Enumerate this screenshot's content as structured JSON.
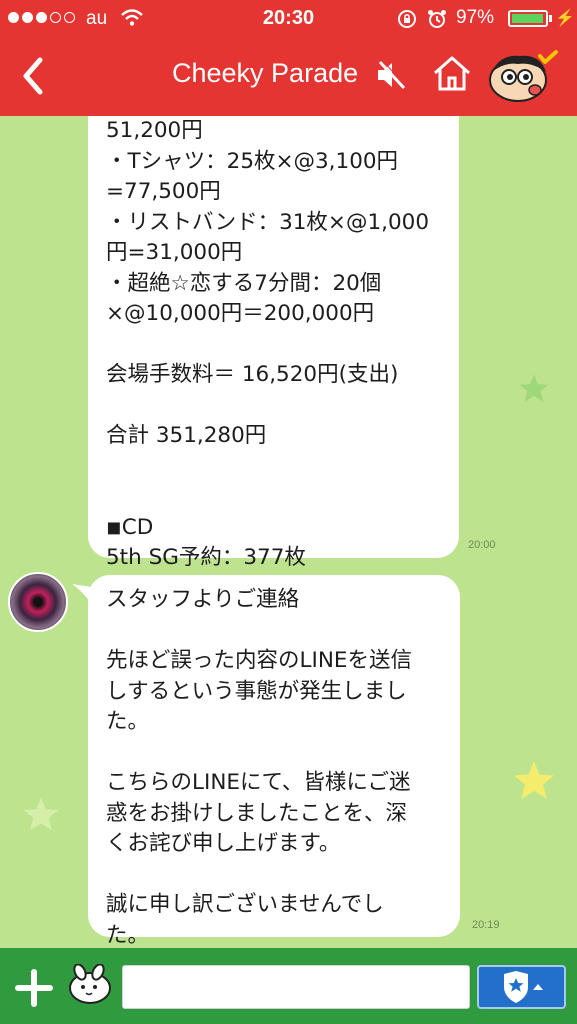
{
  "status_bar": {
    "carrier": "au",
    "time": "20:30",
    "battery_percent": "97%",
    "battery_level": 0.97
  },
  "header": {
    "title": "Cheeky Parade"
  },
  "messages": [
    {
      "lines": [
        "51,200円",
        "・Tシャツ：25枚×@3,100円",
        "=77,500円",
        "・リストバンド：31枚×@1,000",
        "円=31,000円",
        "・超絶☆恋する7分間：20個",
        "×@10,000円＝200,000円",
        "",
        "会場手数料＝ 16,520円(支出)",
        "",
        "合計 351,280円",
        "",
        "",
        "◾CD",
        "5th SG予約：377枚"
      ],
      "time": "20:00"
    },
    {
      "lines": [
        "スタッフよりご連絡",
        "",
        "先ほど誤った内容のLINEを送信",
        "しするという事態が発生しまし",
        "た。",
        "",
        "こちらのLINEにて、皆様にご迷",
        "惑をお掛けしましたことを、深",
        "くお詫び申し上げます。",
        "",
        "誠に申し訳ございませんでし",
        "た。"
      ],
      "time": "20:19"
    }
  ],
  "input": {
    "value": "",
    "placeholder": ""
  },
  "colors": {
    "header_red": "#e43532",
    "chat_bg": "#bde38f",
    "toolbar_green": "#2f9b3e",
    "send_blue": "#2270c9"
  },
  "icons": [
    "back-icon",
    "mute-icon",
    "home-icon",
    "character-avatar-icon",
    "plus-icon",
    "sticker-icon",
    "shield-star-icon"
  ]
}
